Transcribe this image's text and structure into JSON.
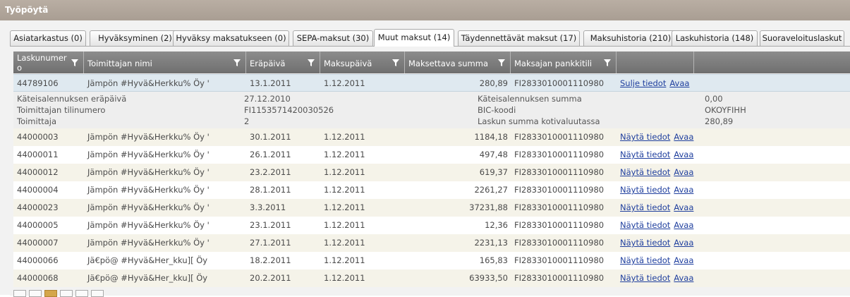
{
  "window": {
    "title": "Työpöytä"
  },
  "tabs": [
    {
      "label": "Asiatarkastus (0)"
    },
    {
      "label": "Hyväksyminen (2)"
    },
    {
      "label": "Hyväksy maksatukseen (0)"
    },
    {
      "label": "SEPA-maksut (30)"
    },
    {
      "label": "Muut maksut (14)",
      "active": true
    },
    {
      "label": "Täydennettävät maksut (17)"
    },
    {
      "label": "Maksuhistoria (210)"
    },
    {
      "label": "Laskuhistoria (148)"
    },
    {
      "label": "Suoraveloituslaskut"
    }
  ],
  "columns": [
    {
      "label": "Laskunumero"
    },
    {
      "label": "Toimittajan nimi"
    },
    {
      "label": "Eräpäivä"
    },
    {
      "label": "Maksupäivä"
    },
    {
      "label": "Maksettava summa"
    },
    {
      "label": "Maksajan pankkitili"
    }
  ],
  "selected_row": {
    "invoice": "44789106",
    "supplier": "Jämpön #Hyvä&Herkku% Öy '",
    "due": "13.1.2011",
    "pay": "1.12.2011",
    "amount": "280,89",
    "account": "FI2833010001110980",
    "link1": "Sulje tiedot",
    "link2": "Avaa"
  },
  "details": {
    "l1": "Käteisalennuksen eräpäivä",
    "v1": "27.12.2010",
    "l2": "Käteisalennuksen summa",
    "v2": "0,00",
    "l3": "Toimittajan tilinumero",
    "v3": "FI1153571420030526",
    "l4": "BIC-koodi",
    "v4": "OKOYFIHH",
    "l5": "Toimittaja",
    "v5": "2",
    "l6": "Laskun summa kotivaluutassa",
    "v6": "280,89"
  },
  "rows": [
    {
      "invoice": "44000003",
      "supplier": "Jämpön #Hyvä&Herkku% Öy '",
      "due": "30.1.2011",
      "pay": "1.12.2011",
      "amount": "1184,18",
      "account": "FI2833010001110980",
      "link1": "Näytä tiedot",
      "link2": "Avaa"
    },
    {
      "invoice": "44000011",
      "supplier": "Jämpön #Hyvä&Herkku% Öy '",
      "due": "26.1.2011",
      "pay": "1.12.2011",
      "amount": "497,48",
      "account": "FI2833010001110980",
      "link1": "Näytä tiedot",
      "link2": "Avaa"
    },
    {
      "invoice": "44000012",
      "supplier": "Jämpön #Hyvä&Herkku% Öy '",
      "due": "23.2.2011",
      "pay": "1.12.2011",
      "amount": "619,37",
      "account": "FI2833010001110980",
      "link1": "Näytä tiedot",
      "link2": "Avaa"
    },
    {
      "invoice": "44000004",
      "supplier": "Jämpön #Hyvä&Herkku% Öy '",
      "due": "28.1.2011",
      "pay": "1.12.2011",
      "amount": "2261,27",
      "account": "FI2833010001110980",
      "link1": "Näytä tiedot",
      "link2": "Avaa"
    },
    {
      "invoice": "44000023",
      "supplier": "Jämpön #Hyvä&Herkku% Öy '",
      "due": "3.3.2011",
      "pay": "1.12.2011",
      "amount": "37231,88",
      "account": "FI2833010001110980",
      "link1": "Näytä tiedot",
      "link2": "Avaa"
    },
    {
      "invoice": "44000005",
      "supplier": "Jämpön #Hyvä&Herkku% Öy '",
      "due": "23.1.2011",
      "pay": "1.12.2011",
      "amount": "12,36",
      "account": "FI2833010001110980",
      "link1": "Näytä tiedot",
      "link2": "Avaa"
    },
    {
      "invoice": "44000007",
      "supplier": "Jämpön #Hyvä&Herkku% Öy '",
      "due": "27.1.2011",
      "pay": "1.12.2011",
      "amount": "2231,13",
      "account": "FI2833010001110980",
      "link1": "Näytä tiedot",
      "link2": "Avaa"
    },
    {
      "invoice": "44000066",
      "supplier": "Jä€pö@ #Hyvä&Her_kku][ Öy",
      "due": "18.2.2011",
      "pay": "1.12.2011",
      "amount": "165,83",
      "account": "FI2833010001110980",
      "link1": "Näytä tiedot",
      "link2": "Avaa"
    },
    {
      "invoice": "44000068",
      "supplier": "Jä€pö@ #Hyvä&Her_kku][ Öy",
      "due": "20.2.2011",
      "pay": "1.12.2011",
      "amount": "63933,50",
      "account": "FI2833010001110980",
      "link1": "Näytä tiedot",
      "link2": "Avaa"
    }
  ],
  "icons": {
    "filter": "filter-funnel-icon"
  },
  "colors": {
    "header_bg": "#7d7d7d",
    "selected_row": "#dfe9f0",
    "alt_row": "#f5f3e9",
    "link": "#1f3f9e",
    "titlebar": "#b0a59a"
  }
}
